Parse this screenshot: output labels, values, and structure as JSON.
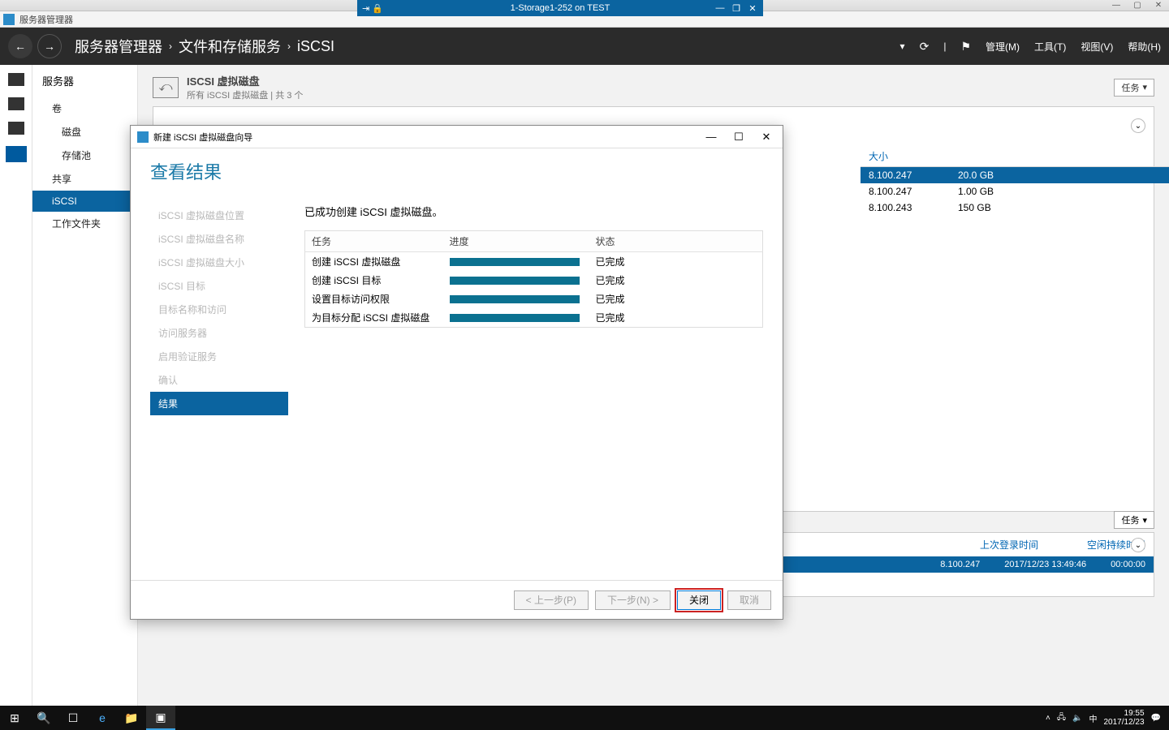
{
  "os_window": {
    "min": "—",
    "max": "▢",
    "close": "✕"
  },
  "remote_bar": {
    "title": "1-Storage1-252 on TEST",
    "pin": "⇥ 🔒",
    "min": "—",
    "max": "❐",
    "close": "✕"
  },
  "sm_titlebar": {
    "title": "服务器管理器"
  },
  "sm_header": {
    "back": "←",
    "fwd": "→",
    "bc1": "服务器管理器",
    "bc2": "文件和存储服务",
    "bc3": "iSCSI",
    "sep": "›",
    "refresh": "⟳",
    "flag": "⚑",
    "menu_manage": "管理(M)",
    "menu_tools": "工具(T)",
    "menu_view": "视图(V)",
    "menu_help": "帮助(H)"
  },
  "nav": {
    "top": "服务器",
    "items": [
      "卷",
      "磁盘",
      "存储池",
      "共享",
      "iSCSI",
      "工作文件夹"
    ],
    "selected": "iSCSI"
  },
  "section": {
    "title": "ISCSI 虚拟磁盘",
    "sub": "所有 iSCSI 虚拟磁盘 | 共 3 个",
    "tasks": "任务",
    "chev": "▾",
    "collapse": "⌄"
  },
  "table_peek": {
    "hdr": "大小",
    "rows": [
      {
        "ip": "8.100.247",
        "size": "20.0 GB",
        "sel": true
      },
      {
        "ip": "8.100.247",
        "size": "1.00 GB",
        "sel": false
      },
      {
        "ip": "8.100.243",
        "size": "150 GB",
        "sel": false
      }
    ]
  },
  "lower": {
    "hdr1": "上次登录时间",
    "hdr2": "空闲持续时间",
    "ip": "8.100.247",
    "time": "2017/12/23 13:49:46",
    "idle": "00:00:00"
  },
  "wizard": {
    "title": "新建 iSCSI 虚拟磁盘向导",
    "min": "—",
    "max": "☐",
    "close": "✕",
    "heading": "查看结果",
    "steps": [
      "iSCSI 虚拟磁盘位置",
      "iSCSI 虚拟磁盘名称",
      "iSCSI 虚拟磁盘大小",
      "iSCSI 目标",
      "目标名称和访问",
      "访问服务器",
      "启用验证服务",
      "确认",
      "结果"
    ],
    "active_step": "结果",
    "msg": "已成功创建 iSCSI 虚拟磁盘。",
    "cols": {
      "task": "任务",
      "progress": "进度",
      "status": "状态"
    },
    "rows": [
      {
        "task": "创建 iSCSI 虚拟磁盘",
        "status": "已完成"
      },
      {
        "task": "创建 iSCSI 目标",
        "status": "已完成"
      },
      {
        "task": "设置目标访问权限",
        "status": "已完成"
      },
      {
        "task": "为目标分配 iSCSI 虚拟磁盘",
        "status": "已完成"
      }
    ],
    "btn_prev": "< 上一步(P)",
    "btn_next": "下一步(N) >",
    "btn_close": "关闭",
    "btn_cancel": "取消"
  },
  "taskbar": {
    "start": "⊞",
    "search": "🔍",
    "tasks": "☐",
    "ie": "e",
    "explorer": "📁",
    "sm": "▣",
    "tray_up": "˄",
    "tray_net": "🖧",
    "tray_vol": "🔈",
    "tray_ime": "中",
    "time": "19:55",
    "date": "2017/12/23",
    "action": "💬"
  }
}
